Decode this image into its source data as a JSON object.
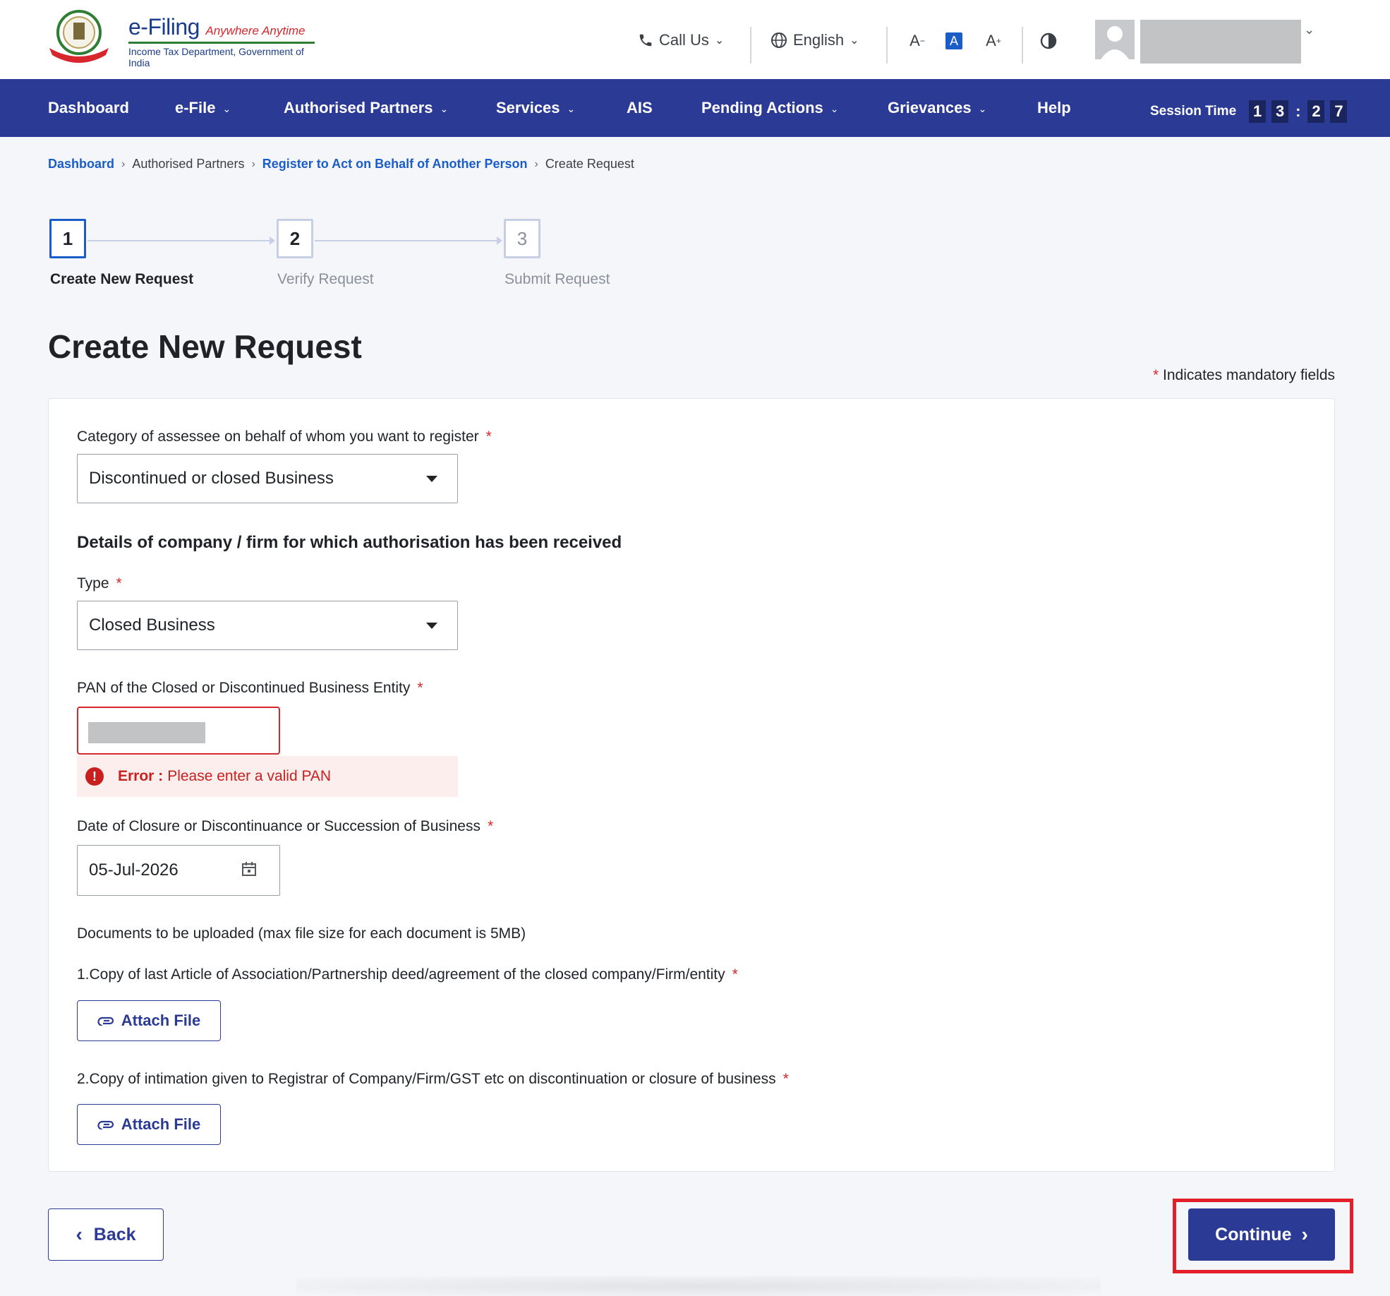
{
  "header": {
    "brand_title": "e-Filing",
    "brand_tagline": "Anywhere Anytime",
    "brand_subtitle": "Income Tax Department, Government of India",
    "call_us": "Call Us",
    "language": "English",
    "font_decrease": "A",
    "font_default": "A",
    "font_increase": "A"
  },
  "nav": {
    "items": [
      "Dashboard",
      "e-File",
      "Authorised Partners",
      "Services",
      "AIS",
      "Pending Actions",
      "Grievances",
      "Help"
    ],
    "session_label": "Session Time",
    "session_digits": [
      "1",
      "3",
      "2",
      "7"
    ]
  },
  "breadcrumb": [
    "Dashboard",
    "Authorised Partners",
    "Register to Act on Behalf of Another Person",
    "Create Request"
  ],
  "stepper": {
    "steps": [
      {
        "num": "1",
        "label": "Create New Request"
      },
      {
        "num": "2",
        "label": "Verify Request"
      },
      {
        "num": "3",
        "label": "Submit Request"
      }
    ]
  },
  "page_title": "Create New Request",
  "mandatory_note": "Indicates mandatory fields",
  "form": {
    "category_label": "Category of assessee on behalf of whom you want to register",
    "category_value": "Discontinued or closed Business",
    "details_heading": "Details of company / firm for which authorisation has been received",
    "type_label": "Type",
    "type_value": "Closed Business",
    "pan_label": "PAN of the Closed or Discontinued Business Entity",
    "error_prefix": "Error :",
    "error_message": "Please enter a valid PAN",
    "date_label": "Date of Closure or Discontinuance or Succession of Business",
    "date_value": "05-Jul-2026",
    "documents_label": "Documents to be uploaded  (max file size for each document is 5MB)",
    "doc1_label": "1.Copy of last Article of Association/Partnership deed/agreement of the closed company/Firm/entity",
    "doc2_label": "2.Copy of intimation given to Registrar of Company/Firm/GST etc on discontinuation or closure of business",
    "attach_label": "Attach File"
  },
  "buttons": {
    "back": "Back",
    "continue": "Continue"
  },
  "colors": {
    "nav_bg": "#2b3a95",
    "link": "#1a5cc8",
    "error": "#c8201e",
    "highlight": "#e3202a"
  }
}
